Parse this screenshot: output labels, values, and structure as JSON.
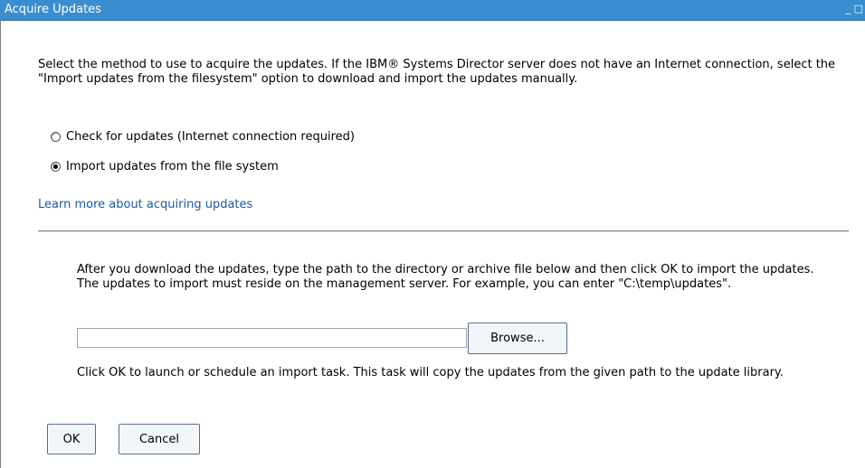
{
  "window": {
    "title": "Acquire Updates",
    "controls": "_ □"
  },
  "intro_text": "Select the method to use to acquire the updates. If the IBM® Systems Director server does not have an Internet connection, select the \"Import updates from the filesystem\" option to download and import the updates manually.",
  "options": [
    {
      "label": "Check for updates (Internet connection required)",
      "selected": false
    },
    {
      "label": "Import updates from the file system",
      "selected": true
    }
  ],
  "learn_more_link": "Learn more about acquiring updates",
  "import_section": {
    "instructions": "After you download the updates, type the path to the directory or archive file below and then click OK to import the updates. The updates to import must reside on the management server. For example, you can enter \"C:\\temp\\updates\".",
    "path_value": "",
    "browse_label": "Browse...",
    "launch_note": "Click OK to launch or schedule an import task. This task will copy the updates from the given path to the update library."
  },
  "buttons": {
    "ok_label": "OK",
    "cancel_label": "Cancel"
  }
}
